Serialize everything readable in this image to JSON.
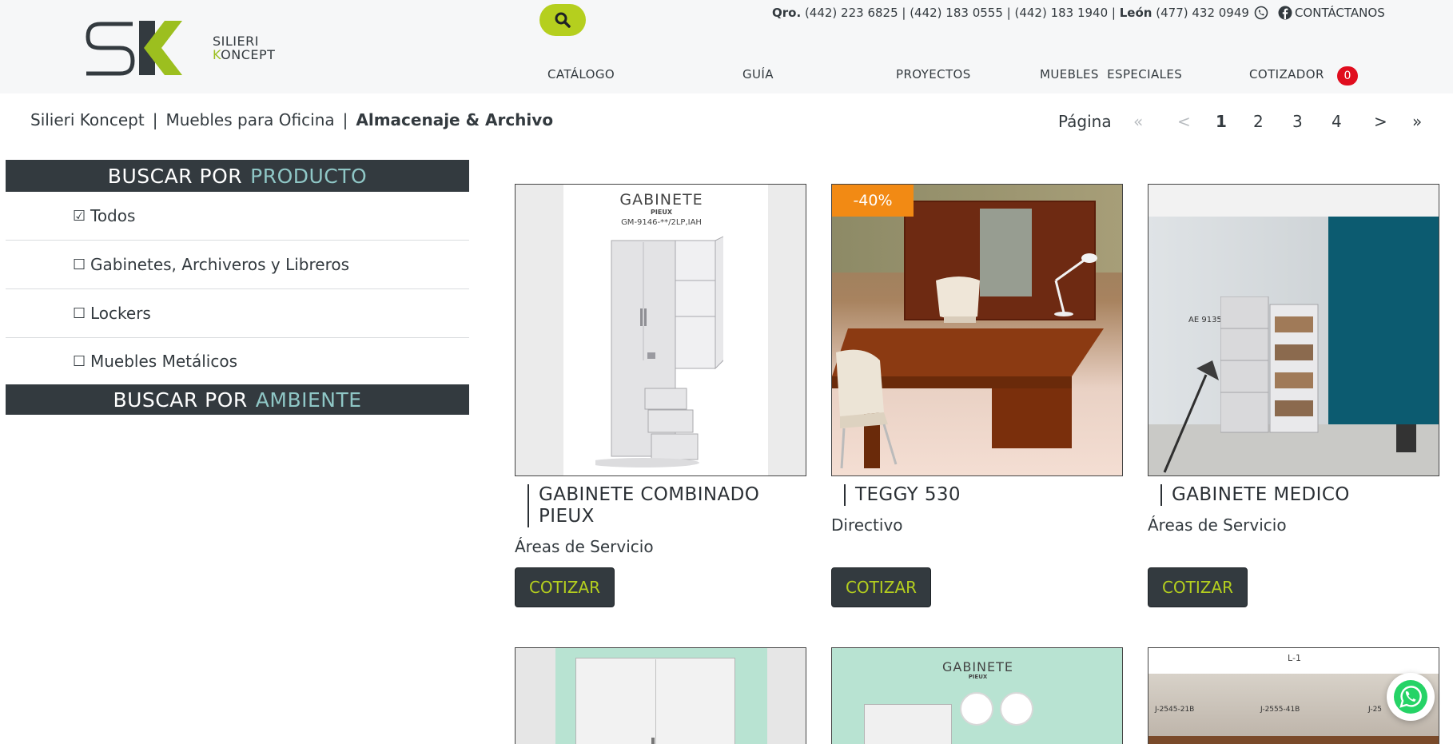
{
  "brand": {
    "logo_letters": "SK",
    "name_line1": "SILIERI",
    "name_line2_k": "K",
    "name_line2_rest": "ONCEPT",
    "accent_color": "#b5cf1e",
    "dark_color": "#333a3f"
  },
  "header": {
    "contact": {
      "city1": "Qro.",
      "phones1": "(442) 223 6825 | (442) 183 0555 | (442) 183 1940 |",
      "city2": "León",
      "phones2": "(477) 432 0949",
      "contact_label": "CONTÁCTANOS"
    },
    "nav": [
      {
        "label": "CATÁLOGO"
      },
      {
        "label": "GUÍA"
      },
      {
        "label": "PROYECTOS"
      },
      {
        "label": "MUEBLES  ESPECIALES"
      },
      {
        "label": "COTIZADOR"
      }
    ],
    "cart_count": "0"
  },
  "breadcrumb": {
    "items": [
      "Silieri Koncept",
      "Muebles para Oficina"
    ],
    "separator": "|",
    "current": "Almacenaje & Archivo"
  },
  "pagination": {
    "label": "Página",
    "first": "«",
    "prev": "<",
    "pages": [
      "1",
      "2",
      "3",
      "4"
    ],
    "current_page": "1",
    "next": ">",
    "last": "»"
  },
  "sidebar": {
    "product_heading_prefix": "BUSCAR POR",
    "product_heading_accent": "PRODUCTO",
    "items": [
      {
        "checked_glyph": "☑",
        "label": "Todos",
        "checked": true
      },
      {
        "checked_glyph": "☐",
        "label": "Gabinetes, Archiveros y Libreros",
        "checked": false
      },
      {
        "checked_glyph": "☐",
        "label": "Lockers",
        "checked": false
      },
      {
        "checked_glyph": "☐",
        "label": "Muebles Metálicos",
        "checked": false
      }
    ],
    "ambient_heading_prefix": "BUSCAR POR",
    "ambient_heading_accent": "AMBIENTE"
  },
  "products": [
    {
      "title": "GABINETE COMBINADO PIEUX",
      "category": "Áreas de Servicio",
      "button": "COTIZAR",
      "image_heading": "GABINETE",
      "image_sub": "PIEUX",
      "image_code": "GM-9146-**/2LP,IAH"
    },
    {
      "title": "TEGGY 530",
      "category": "Directivo",
      "button": "COTIZAR",
      "badge": "-40%"
    },
    {
      "title": "GABINETE MEDICO",
      "category": "Áreas de Servicio",
      "button": "COTIZAR",
      "image_label": "AE 9135"
    }
  ],
  "products_row2": [
    {
      "image_heading": ""
    },
    {
      "image_heading": "GABINETE",
      "image_sub": "PIEUX"
    },
    {
      "image_heading": "L-1",
      "codes": [
        "J-2545-21B",
        "J-2555-41B",
        "J-25"
      ]
    }
  ],
  "icons": {
    "search": "search-icon",
    "whatsapp": "whatsapp-icon",
    "facebook": "facebook-icon"
  }
}
